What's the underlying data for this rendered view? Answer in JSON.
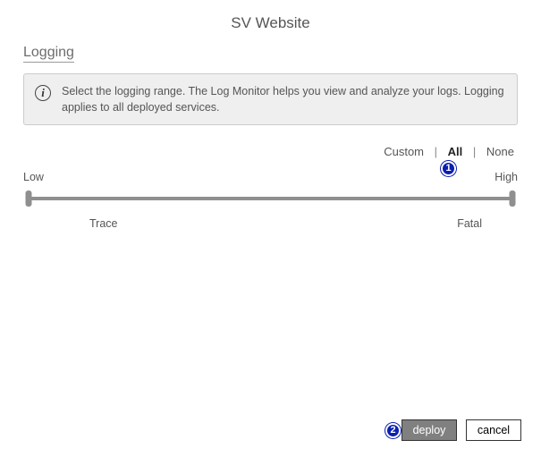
{
  "title": "SV Website",
  "section": "Logging",
  "info_text": "Select the logging range. The Log Monitor helps you view and analyze your logs. Logging applies to all deployed services.",
  "range_options": {
    "custom": "Custom",
    "all": "All",
    "none": "None",
    "separator": "|"
  },
  "slider": {
    "low_label": "Low",
    "high_label": "High",
    "left_tick": "Trace",
    "right_tick": "Fatal"
  },
  "buttons": {
    "deploy": "deploy",
    "cancel": "cancel"
  },
  "callouts": {
    "one": "1",
    "two": "2"
  }
}
